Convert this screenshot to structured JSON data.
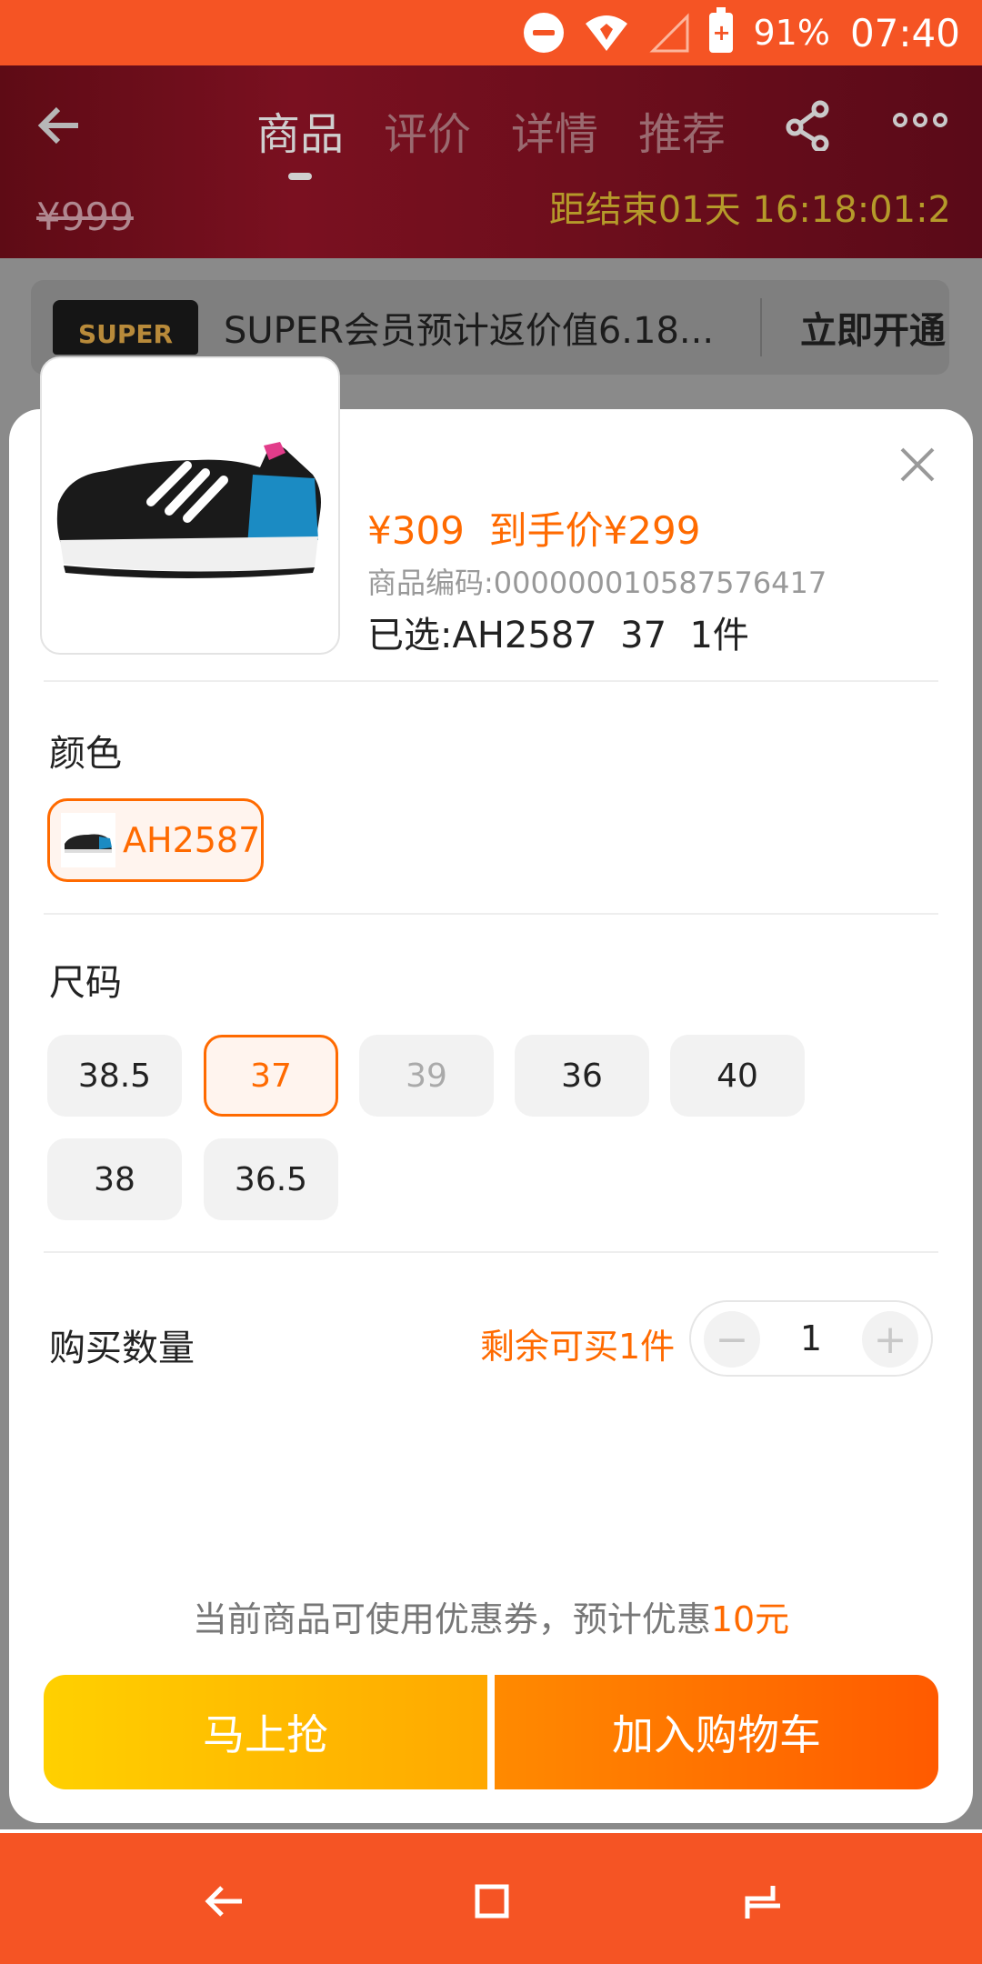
{
  "status_bar": {
    "battery": "91%",
    "time": "07:40"
  },
  "background": {
    "tabs": [
      "商品",
      "评价",
      "详情",
      "推荐"
    ],
    "active_tab": "商品",
    "old_price": "¥999",
    "countdown": "距结束01天 16:18:01:2",
    "super_logo": "SUPER",
    "super_text": "SUPER会员预计返价值6.18...",
    "super_action": "立即开通"
  },
  "sheet": {
    "price_line": "¥309  到手价¥299",
    "code_line": "商品编码:000000010587576417",
    "selected_line": "已选:AH2587  37  1件",
    "color_title": "颜色",
    "color_option": "AH2587",
    "size_title": "尺码",
    "sizes": [
      {
        "label": "38.5",
        "state": "normal"
      },
      {
        "label": "37",
        "state": "selected"
      },
      {
        "label": "39",
        "state": "disabled"
      },
      {
        "label": "36",
        "state": "normal"
      },
      {
        "label": "40",
        "state": "normal"
      },
      {
        "label": "38",
        "state": "normal"
      },
      {
        "label": "36.5",
        "state": "normal"
      }
    ],
    "qty_label": "购买数量",
    "remain_text": "剩余可买1件",
    "qty_value": "1",
    "minus_symbol": "−",
    "plus_symbol": "+",
    "coupon_prefix": "当前商品可使用优惠券，预计优惠",
    "coupon_amount": "10元",
    "buy_now_label": "马上抢",
    "add_cart_label": "加入购物车"
  },
  "colors": {
    "accent": "#ff6a00",
    "status_bar": "#f55424"
  }
}
